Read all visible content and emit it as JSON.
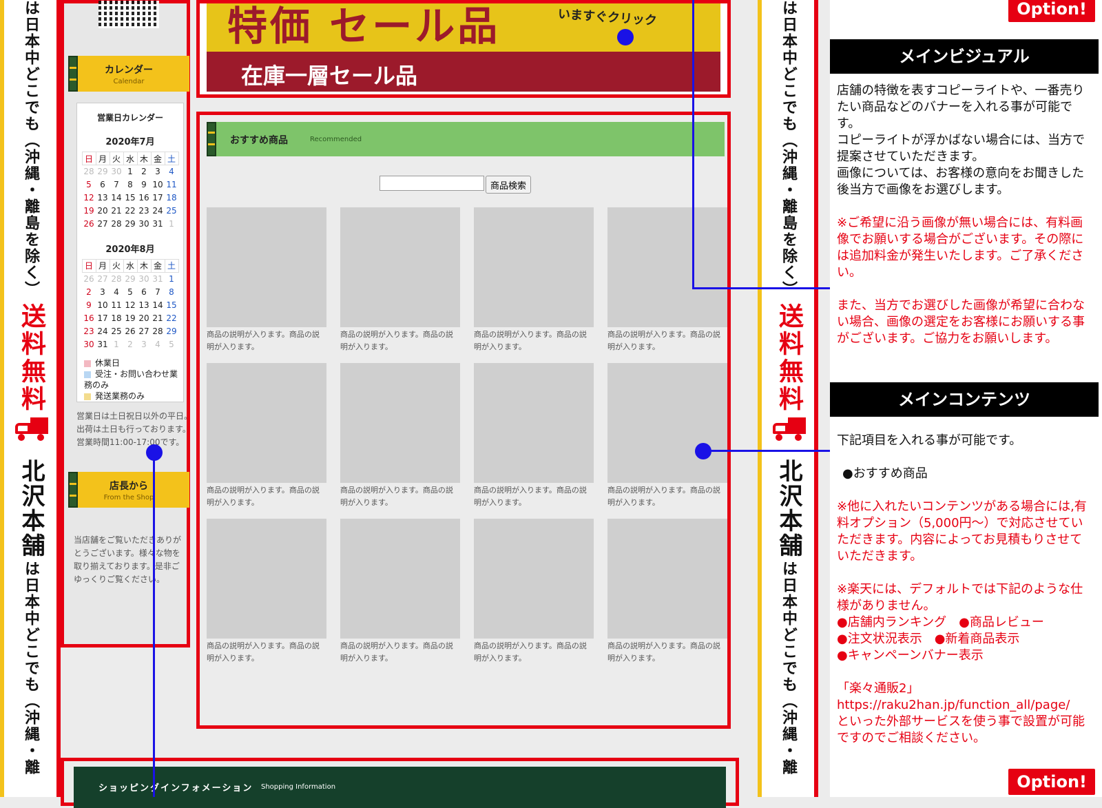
{
  "side_banner": {
    "top_fragment": "は日本中どこでも（沖縄・離島を除く）",
    "free_shipping": "送料無料",
    "store_name": "北沢本舗",
    "bottom_fragment": "は日本中どこでも（沖縄・離"
  },
  "banner": {
    "big_text": "特価 セール品",
    "click_text": "いますぐクリック",
    "sub_text": "在庫一層セール品"
  },
  "calendar": {
    "head_title": "カレンダー",
    "head_sub": "Calendar",
    "box_title": "営業日カレンダー",
    "weekdays": [
      "日",
      "月",
      "火",
      "水",
      "木",
      "金",
      "土"
    ],
    "month1": "2020年7月",
    "month1_weeks": [
      [
        "28",
        "29",
        "30",
        "1",
        "2",
        "3",
        "4"
      ],
      [
        "5",
        "6",
        "7",
        "8",
        "9",
        "10",
        "11"
      ],
      [
        "12",
        "13",
        "14",
        "15",
        "16",
        "17",
        "18"
      ],
      [
        "19",
        "20",
        "21",
        "22",
        "23",
        "24",
        "25"
      ],
      [
        "26",
        "27",
        "28",
        "29",
        "30",
        "31",
        "1"
      ]
    ],
    "month2": "2020年8月",
    "month2_weeks": [
      [
        "26",
        "27",
        "28",
        "29",
        "30",
        "31",
        "1"
      ],
      [
        "2",
        "3",
        "4",
        "5",
        "6",
        "7",
        "8"
      ],
      [
        "9",
        "10",
        "11",
        "12",
        "13",
        "14",
        "15"
      ],
      [
        "16",
        "17",
        "18",
        "19",
        "20",
        "21",
        "22"
      ],
      [
        "23",
        "24",
        "25",
        "26",
        "27",
        "28",
        "29"
      ],
      [
        "30",
        "31",
        "1",
        "2",
        "3",
        "4",
        "5"
      ]
    ],
    "legend": [
      "休業日",
      "受注・お問い合わせ業務のみ",
      "発送業務のみ"
    ],
    "legend_colors": [
      "#f3b9c2",
      "#b9d7f3",
      "#f3dc8e"
    ],
    "business_note": "営業日は土日祝日以外の平日。出荷は土日も行っております。営業時間11:00-17:00です。"
  },
  "manager": {
    "head_title": "店長から",
    "head_sub": "From the Shop",
    "message": "当店舗をご覧いただきありがとうございます。様々な物を取り揃えております。是非ごゆっくりご覧ください。"
  },
  "recommended": {
    "title": "おすすめ商品",
    "sub": "Recommended",
    "search_button": "商品検索",
    "item_desc": "商品の説明が入ります。商品の説明が入ります。",
    "item_count": 12
  },
  "shopping_info": {
    "title": "ショッピングインフォメーション",
    "sub": "Shopping Information"
  },
  "notes": {
    "option_label": "Option!",
    "main_visual_title": "メインビジュアル",
    "main_visual_text": "店舗の特徴を表すコピーライトや、一番売りたい商品などのバナーを入れる事が可能です。\nコピーライトが浮かばない場合には、当方で提案させていただきます。\n画像については、お客様の意向をお聞きした後当方で画像をお選びします。",
    "main_visual_red1": "※ご希望に沿う画像が無い場合には、有料画像でお願いする場合がございます。その際には追加料金が発生いたします。ご了承ください。",
    "main_visual_red2": "また、当方でお選びした画像が希望に合わない場合、画像の選定をお客様にお願いする事がございます。ご協力をお願いします。",
    "main_content_title": "メインコンテンツ",
    "main_content_text": "下記項目を入れる事が可能です。",
    "main_content_item": "●おすすめ商品",
    "main_content_red": "※他に入れたいコンテンツがある場合には,有料オプション（5,000円〜）で対応させていただきます。内容によってお見積もりさせていただきます。\n\n※楽天には、デフォルトでは下記のような仕様がありません。\n●店舗内ランキング　●商品レビュー\n●注文状況表示　●新着商品表示\n●キャンペーンバナー表示\n\n「楽々通販2」\nhttps://raku2han.jp/function_all/page/\nといった外部サービスを使う事で設置が可能ですのでご相談ください。"
  },
  "colors": {
    "accent_red": "#e60012",
    "connector_blue": "#1a12e6",
    "header_green": "#7ec46a",
    "header_yellow": "#f3c21b"
  }
}
